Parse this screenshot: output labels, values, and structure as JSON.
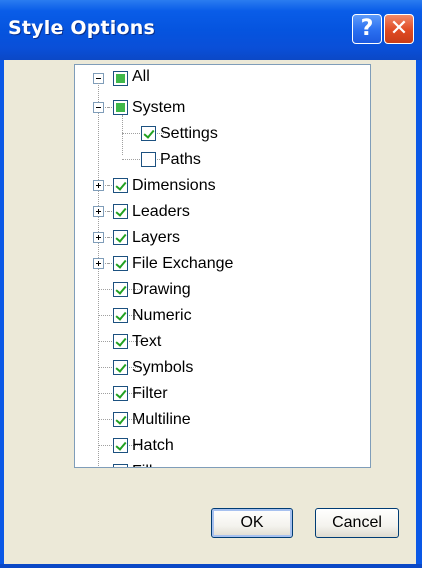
{
  "window": {
    "title": "Style Options"
  },
  "titlebar_buttons": {
    "help_glyph": "?",
    "close_glyph": "✕"
  },
  "tree": {
    "root": {
      "label": "All",
      "state": "partial",
      "expanded": true
    },
    "items": [
      {
        "label": "System",
        "state": "partial",
        "expander": "minus"
      },
      {
        "label": "Settings",
        "state": "checked",
        "expander": ""
      },
      {
        "label": "Paths",
        "state": "unchecked",
        "expander": ""
      },
      {
        "label": "Dimensions",
        "state": "checked",
        "expander": "plus"
      },
      {
        "label": "Leaders",
        "state": "checked",
        "expander": "plus"
      },
      {
        "label": "Layers",
        "state": "checked",
        "expander": "plus"
      },
      {
        "label": "File Exchange",
        "state": "checked",
        "expander": "plus"
      },
      {
        "label": "Drawing",
        "state": "checked",
        "expander": ""
      },
      {
        "label": "Numeric",
        "state": "checked",
        "expander": ""
      },
      {
        "label": "Text",
        "state": "checked",
        "expander": ""
      },
      {
        "label": "Symbols",
        "state": "checked",
        "expander": ""
      },
      {
        "label": "Filter",
        "state": "checked",
        "expander": ""
      },
      {
        "label": "Multiline",
        "state": "checked",
        "expander": ""
      },
      {
        "label": "Hatch",
        "state": "checked",
        "expander": ""
      },
      {
        "label": "Fill",
        "state": "checked",
        "expander": ""
      }
    ]
  },
  "buttons": {
    "ok_label": "OK",
    "cancel_label": "Cancel"
  },
  "icons": {
    "scroll_up": "scroll-up-icon",
    "scroll_down": "scroll-down-icon"
  },
  "colors": {
    "title_bar": "#0554df",
    "dialog_bg": "#ece9d8",
    "check": "#21a121",
    "close_button": "#e04a22"
  }
}
